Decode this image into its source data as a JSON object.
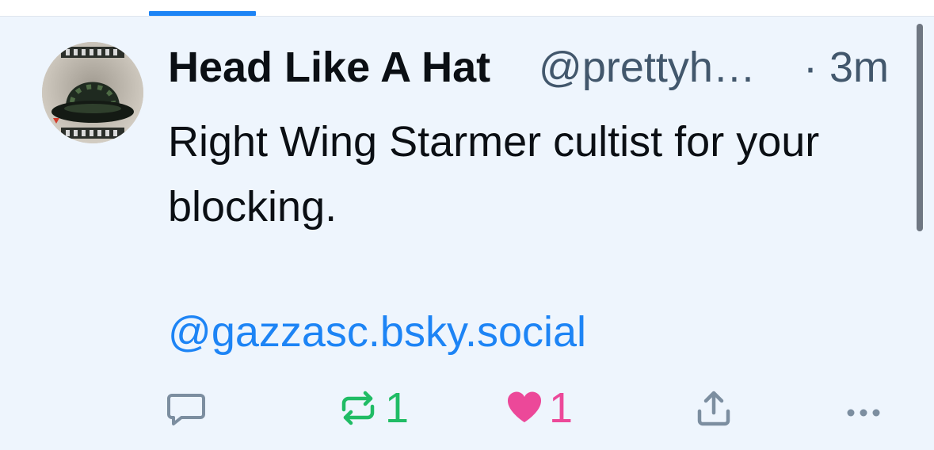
{
  "post": {
    "author": {
      "display_name": "Head Like A Hat",
      "handle": "@prettyh…",
      "avatar_icon": "bowler-hat-avatar"
    },
    "time_separator": "·",
    "time_ago": "3m",
    "text": "Right Wing Starmer cultist for your blocking.",
    "mention": "@gazzasc.bsky.social"
  },
  "actions": {
    "reply": {
      "icon": "reply-icon",
      "count": ""
    },
    "repost": {
      "icon": "repost-icon",
      "count": "1",
      "color": "#20bc65"
    },
    "like": {
      "icon": "heart-icon",
      "count": "1",
      "color": "#ec4899",
      "liked": true
    },
    "share": {
      "icon": "share-icon"
    },
    "more": {
      "icon": "more-icon"
    }
  },
  "colors": {
    "background": "#eef5fd",
    "accent": "#1d84f5",
    "muted_text": "#42576c",
    "icon_gray": "#7c8ea0"
  }
}
